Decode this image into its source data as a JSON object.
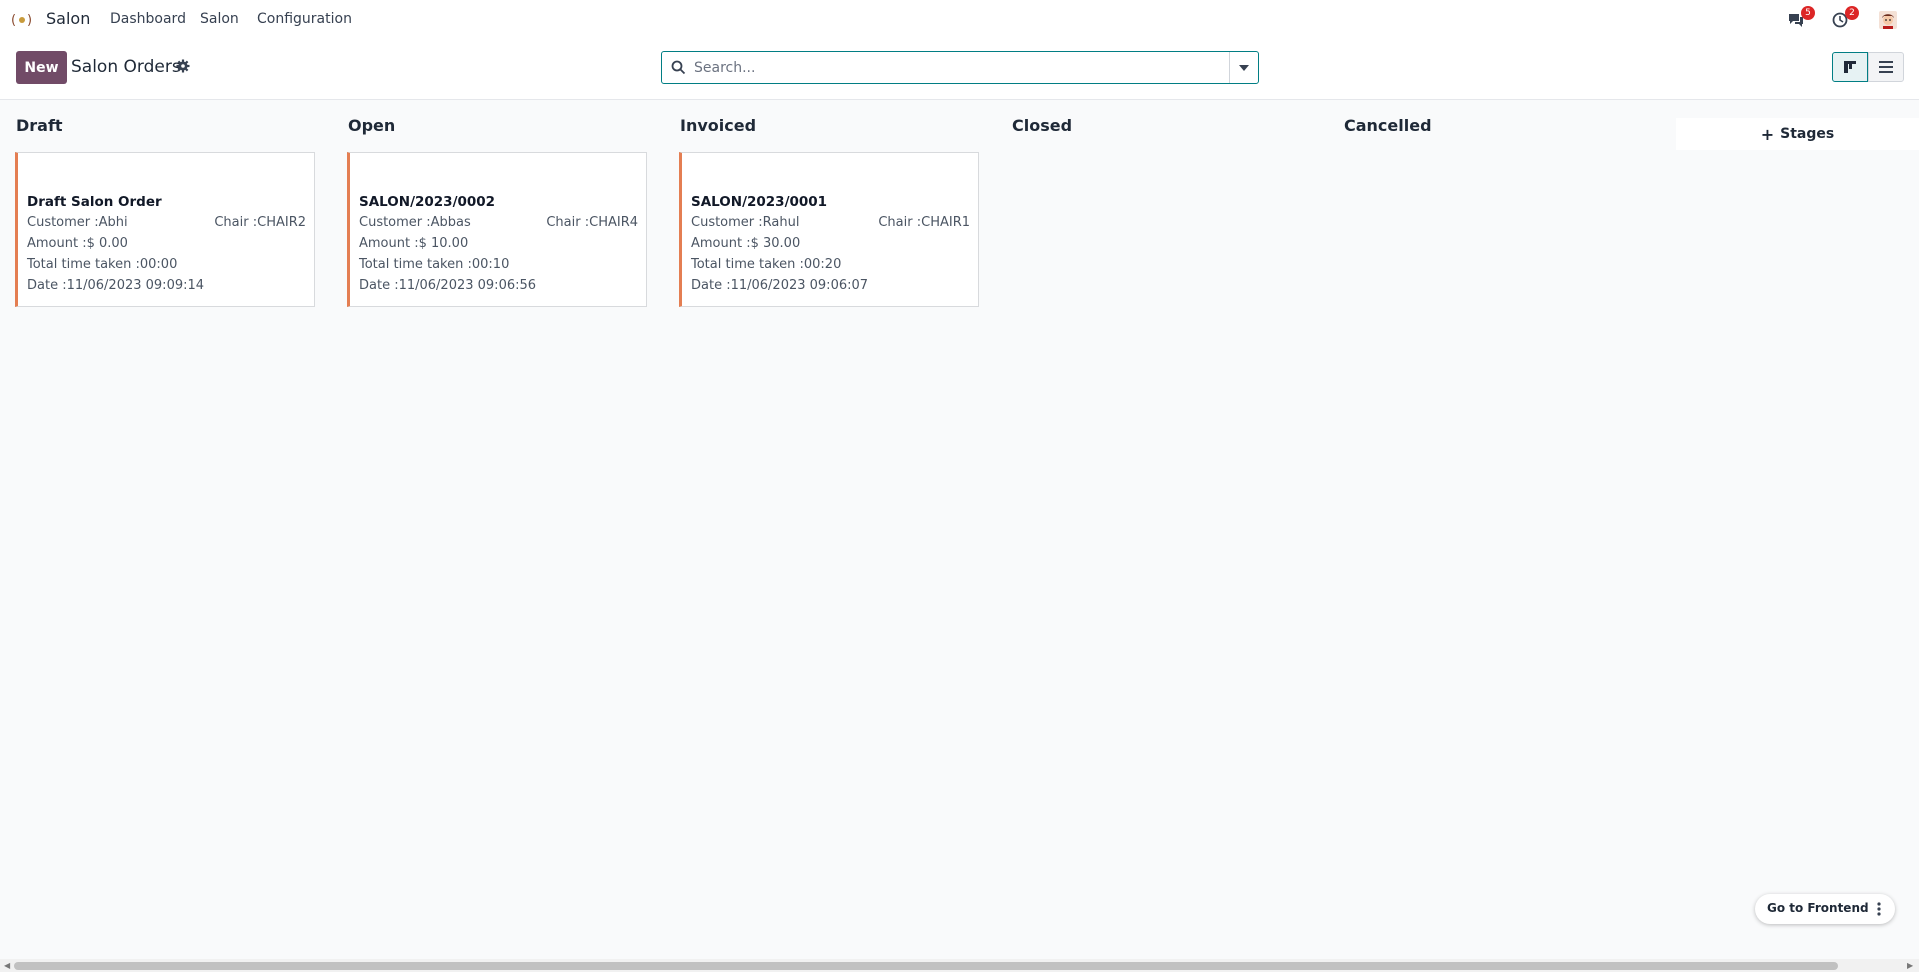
{
  "navbar": {
    "app_name": "Salon",
    "menu": [
      "Dashboard",
      "Salon",
      "Configuration"
    ],
    "messages_count": "5",
    "activities_count": "2"
  },
  "control_panel": {
    "new_label": "New",
    "title": "Salon Orders",
    "search_placeholder": "Search..."
  },
  "columns": [
    {
      "title": "Draft"
    },
    {
      "title": "Open"
    },
    {
      "title": "Invoiced"
    },
    {
      "title": "Closed"
    },
    {
      "title": "Cancelled"
    }
  ],
  "cards": [
    {
      "title": "Draft Salon Order",
      "customer": "Customer :Abhi",
      "chair": "Chair :CHAIR2",
      "amount": "Amount :$ 0.00",
      "time": "Total time taken :00:00",
      "date": "Date :11/06/2023 09:09:14"
    },
    {
      "title": "SALON/2023/0002",
      "customer": "Customer :Abbas",
      "chair": "Chair :CHAIR4",
      "amount": "Amount :$ 10.00",
      "time": "Total time taken :00:10",
      "date": "Date :11/06/2023 09:06:56"
    },
    {
      "title": "SALON/2023/0001",
      "customer": "Customer :Rahul",
      "chair": "Chair :CHAIR1",
      "amount": "Amount :$ 30.00",
      "time": "Total time taken :00:20",
      "date": "Date :11/06/2023 09:06:07"
    }
  ],
  "add_stage_label": "Stages",
  "frontend_label": "Go to Frontend",
  "colors": {
    "primary": "#714b67",
    "accent": "#017e84",
    "card_border": "#e47e52",
    "badge": "#dc2626"
  }
}
